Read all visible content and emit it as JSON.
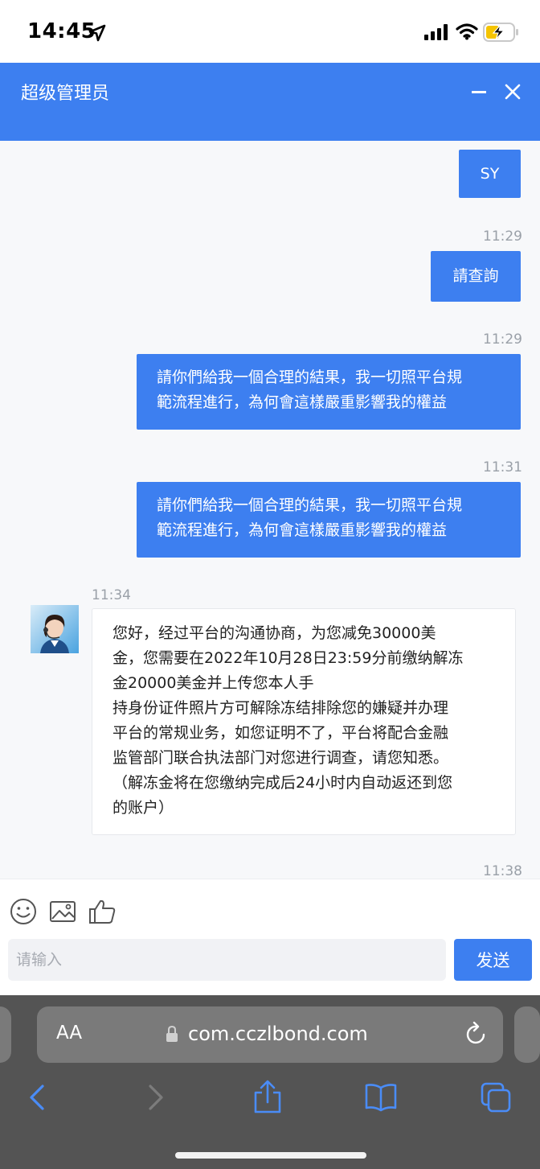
{
  "status": {
    "time": "14:45"
  },
  "header": {
    "title": "超级管理员",
    "minimize_icon": "minimize-icon",
    "close_icon": "close-icon"
  },
  "messages": {
    "m1": {
      "text": "SY"
    },
    "t2": "11:29",
    "m2": {
      "text": "請查詢"
    },
    "t3": "11:29",
    "m3": {
      "line1": "請你們給我一個合理的結果，我一切照平台規",
      "line2": "範流程進行，為何會這樣嚴重影響我的權益"
    },
    "t4": "11:31",
    "m4": {
      "line1": "請你們給我一個合理的結果，我一切照平台規",
      "line2": "範流程進行，為何會這樣嚴重影響我的權益"
    },
    "t5": "11:34",
    "m5": {
      "line1": "您好，经过平台的沟通协商，为您减免30000美",
      "line2": "金，您需要在2022年10月28日23:59分前缴纳解冻",
      "line3": "金20000美金并上传您本人手",
      "line4": "持身份证件照片方可解除冻结排除您的嫌疑并办理",
      "line5": "平台的常规业务，如您证明不了，平台将配合金融",
      "line6": "监管部门联合执法部门对您进行调查，请您知悉。",
      "line7": "（解冻金将在您缴纳完成后24小时内自动返还到您",
      "line8": "的账户）"
    },
    "t6": "11:38"
  },
  "composer": {
    "placeholder": "请输入",
    "send_label": "发送",
    "icons": [
      "emoji-icon",
      "image-icon",
      "thumbs-up-icon"
    ]
  },
  "browser": {
    "aa_label": "AA",
    "url": "com.cczlbond.com"
  },
  "colors": {
    "accent": "#3d7ff0",
    "browser_bar": "#545454",
    "nav_icon": "#4a8cf7"
  }
}
